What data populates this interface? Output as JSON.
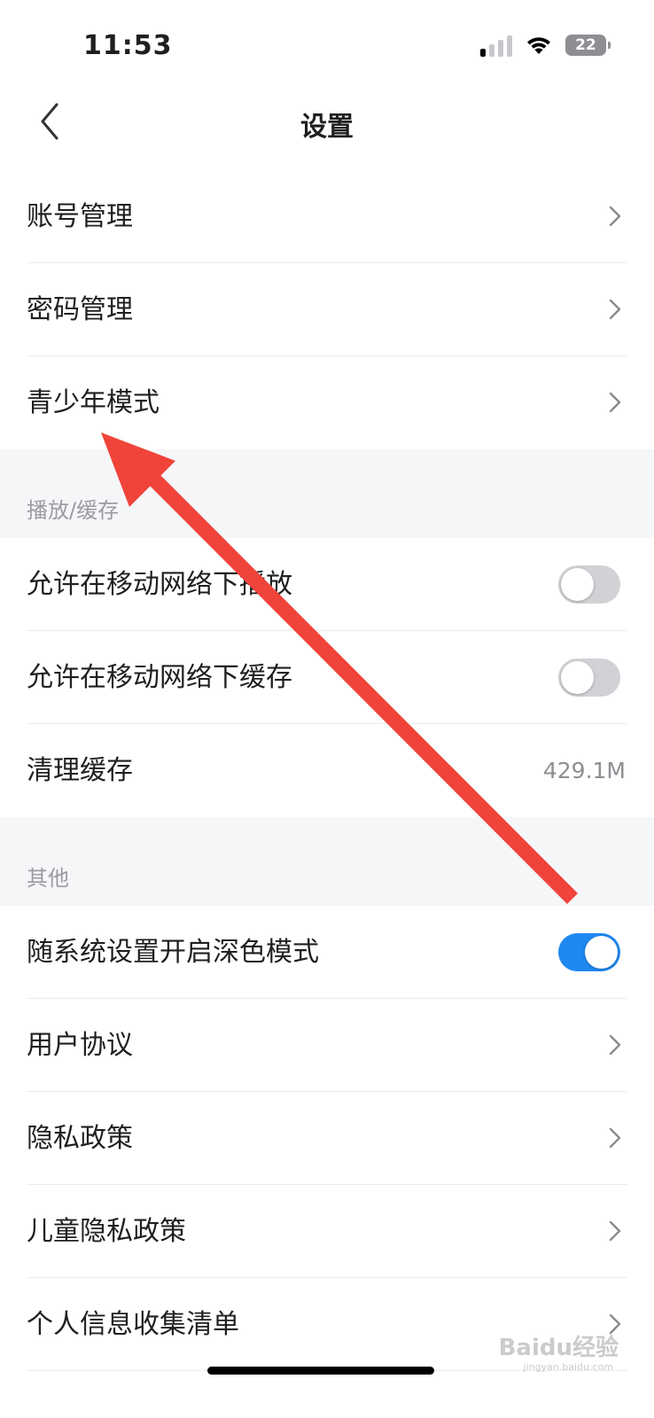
{
  "status_bar": {
    "time": "11:53",
    "battery": "22",
    "signal_bars_active": 1,
    "signal_bars_total": 4
  },
  "nav": {
    "title": "设置"
  },
  "account_group": [
    {
      "label": "账号管理"
    },
    {
      "label": "密码管理"
    },
    {
      "label": "青少年模式"
    }
  ],
  "playback_section": {
    "title": "播放/缓存",
    "items": [
      {
        "label": "允许在移动网络下播放",
        "toggle_on": false
      },
      {
        "label": "允许在移动网络下缓存",
        "toggle_on": false
      },
      {
        "label": "清理缓存",
        "value": "429.1M"
      }
    ]
  },
  "other_section": {
    "title": "其他",
    "items": [
      {
        "label": "随系统设置开启深色模式",
        "toggle_on": true
      },
      {
        "label": "用户协议"
      },
      {
        "label": "隐私政策"
      },
      {
        "label": "儿童隐私政策"
      },
      {
        "label": "个人信息收集清单"
      }
    ]
  },
  "watermark": {
    "text": "Baidu经验",
    "sub": "jingyan.baidu.com"
  },
  "colors": {
    "toggle_on": "#1f88f1",
    "toggle_off": "#d1d1d6",
    "annotation_arrow": "#f0443a",
    "section_bg": "#f5f6f8"
  }
}
